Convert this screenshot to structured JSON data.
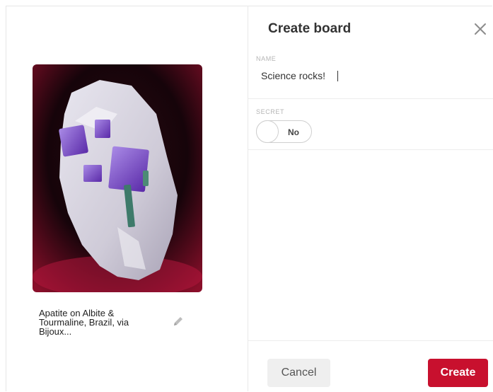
{
  "pin": {
    "image_alt": "Apatite mineral specimen",
    "description": "Apatite on Albite &\nTourmaline, Brazil, via\nBijoux..."
  },
  "dialog": {
    "title": "Create board",
    "name_label": "NAME",
    "name_value": "Science rocks!",
    "secret_label": "SECRET",
    "secret_toggle_text": "No",
    "cancel_label": "Cancel",
    "create_label": "Create"
  },
  "colors": {
    "create_button": "#c8102e",
    "cancel_button": "#efefef",
    "image_background": "#1a0006"
  },
  "icons": {
    "edit": "pencil-icon",
    "close": "close-icon"
  }
}
